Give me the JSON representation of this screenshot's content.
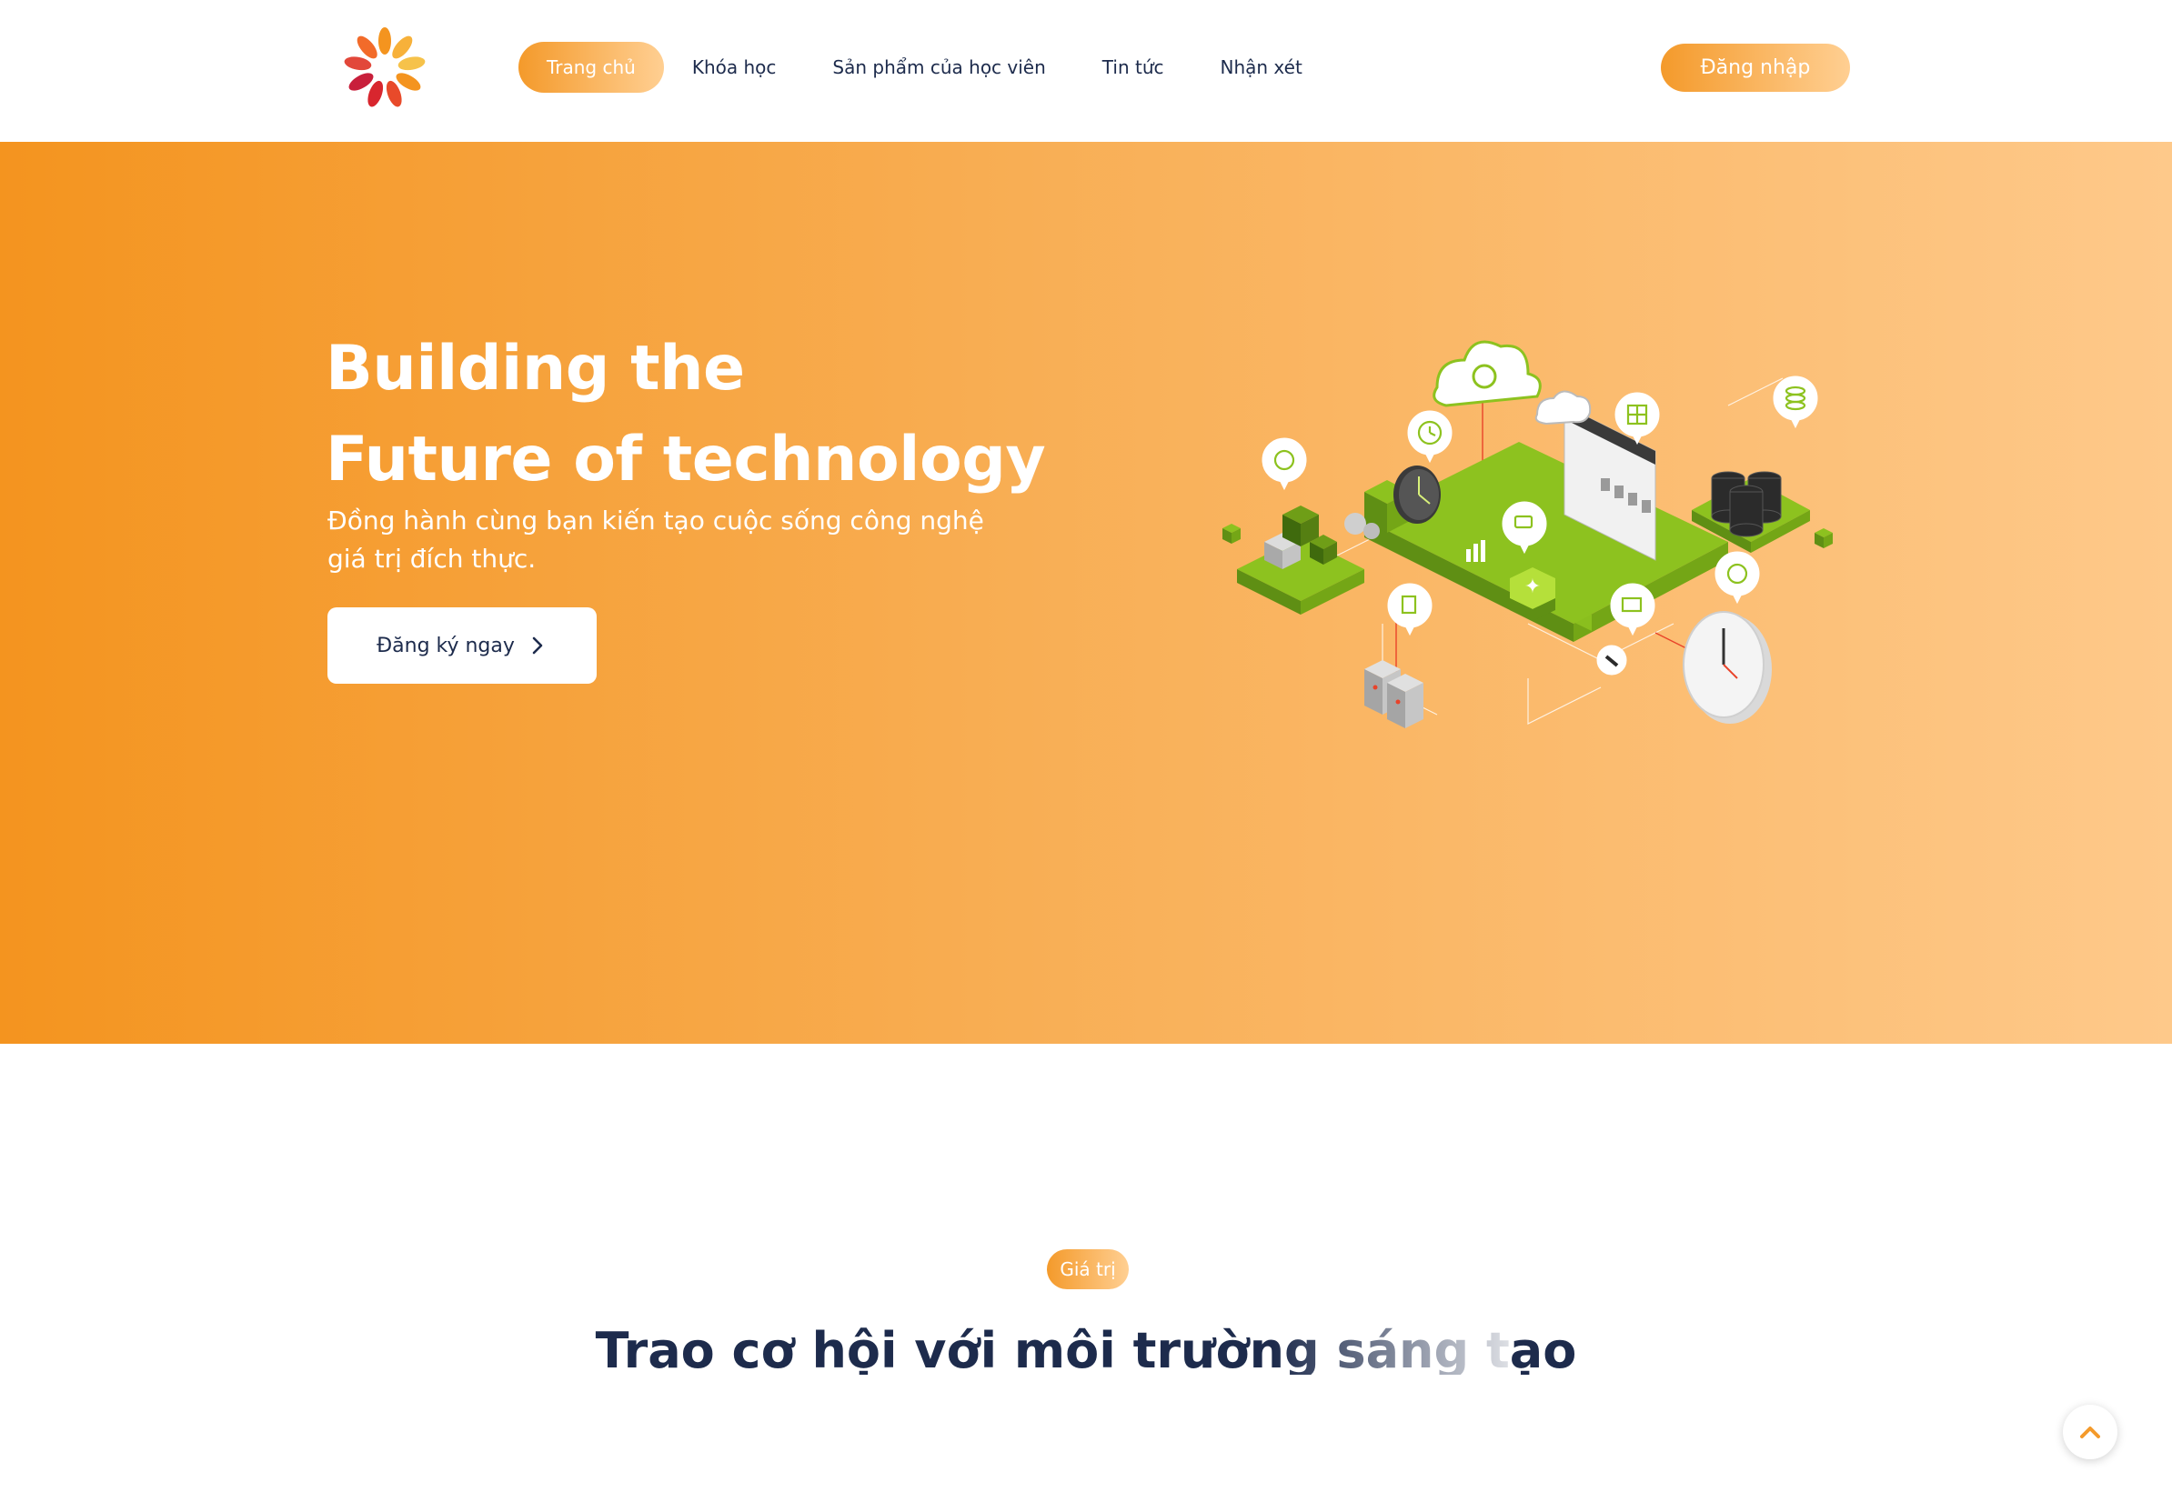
{
  "nav": {
    "items": [
      {
        "label": "Trang chủ",
        "active": true
      },
      {
        "label": "Khóa học",
        "active": false
      },
      {
        "label": "Sản phẩm của học viên",
        "active": false
      },
      {
        "label": "Tin tức",
        "active": false
      },
      {
        "label": "Nhận xét",
        "active": false
      }
    ],
    "login_label": "Đăng nhập"
  },
  "hero": {
    "title_line1": "Building the",
    "title_line2": "Future of technology",
    "subtitle": "Đồng hành cùng bạn kiến tạo cuộc sống công nghệ giá trị đích thực.",
    "cta_label": "Đăng ký ngay"
  },
  "values": {
    "tag": "Giá trị",
    "title": "Trao cơ hội với môi trường sáng tạo"
  },
  "colors": {
    "accent_start": "#f49a2b",
    "accent_end": "#ffcf92",
    "text_dark": "#1d2b4c",
    "illustration_green": "#8dc21f"
  },
  "icons": {
    "logo": "flower-logo-icon",
    "cta": "chevron-right-icon",
    "scroll": "chevron-up-icon"
  }
}
